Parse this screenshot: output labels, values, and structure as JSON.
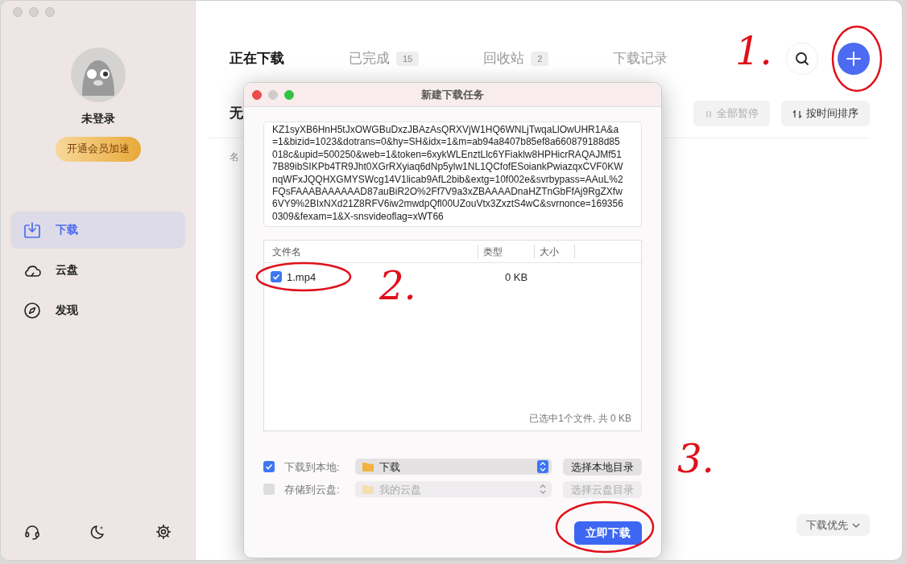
{
  "sidebar": {
    "username": "未登录",
    "vip_button": "开通会员加速",
    "items": [
      {
        "label": "下载",
        "selected": true
      },
      {
        "label": "云盘",
        "selected": false
      },
      {
        "label": "发现",
        "selected": false
      }
    ]
  },
  "tabs": [
    {
      "label": "正在下载",
      "selected": true
    },
    {
      "label": "已完成",
      "count": "15",
      "selected": false
    },
    {
      "label": "回收站",
      "count": "2",
      "selected": false
    },
    {
      "label": "下载记录",
      "selected": false
    }
  ],
  "toolbar": {
    "heading": "无",
    "buttons": [
      {
        "label": "全部暂停",
        "disabled": true
      },
      {
        "label": "按时间排序",
        "disabled": false
      }
    ]
  },
  "list_header": "名",
  "priority_button": "下载优先",
  "dialog": {
    "title": "新建下载任务",
    "url_lines": [
      "KZ1syXB6HnH5tJxOWGBuDxzJBAzAsQRXVjW1HQ6WNLjTwqaLlOwUHR1A&a",
      "=1&bizid=1023&dotrans=0&hy=SH&idx=1&m=ab94a8407b85ef8a660879188d85",
      "018c&upid=500250&web=1&token=6xykWLEnztLlc6YFiaklw8HPHicrRAQAJMf51",
      "7B89ibSIKPb4TR9Jht0XGrRXyiaq6dNp5ylw1NL1QCfofESoiankPwiazqxCVF0KW",
      "nqWFxJQQHXGMYSWcg14V1licab9AfL2bib&extg=10f002e&svrbypass=AAuL%2",
      "FQsFAAABAAAAAAD87auBiR2O%2Ff7V9a3xZBAAAADnaHZTnGbFfAj9RgZXfw",
      "6VY9%2BIxNXd21Z8RFV6iw2mwdpQfl00UZouVtx3ZxztS4wC&svrnonce=169356",
      "0309&fexam=1&X-snsvideoflag=xWT66"
    ],
    "columns": [
      "文件名",
      "类型",
      "大小"
    ],
    "files": [
      {
        "name": "1.mp4",
        "size": "0 KB",
        "checked": true
      }
    ],
    "summary": "已选中1个文件, 共 0 KB",
    "destinations": [
      {
        "label": "下载到本地:",
        "checked": true,
        "disabled": false,
        "folder": "下载",
        "button": "选择本地目录"
      },
      {
        "label": "存储到云盘:",
        "checked": false,
        "disabled": true,
        "folder": "我的云盘",
        "button": "选择云盘目录"
      }
    ],
    "submit": "立即下载"
  },
  "annotations": [
    {
      "text": "1."
    },
    {
      "text": "2."
    },
    {
      "text": "3."
    }
  ]
}
